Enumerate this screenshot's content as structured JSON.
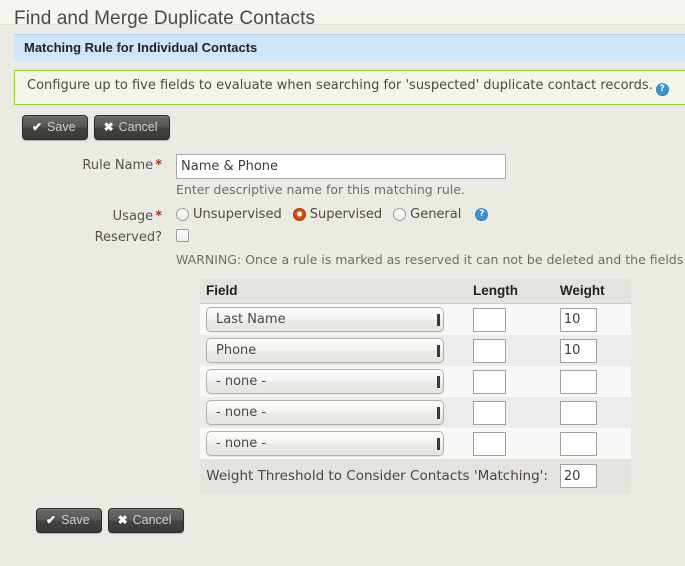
{
  "page": {
    "title": "Find and Merge Duplicate Contacts"
  },
  "section": {
    "header": "Matching Rule for Individual Contacts",
    "help_message": "Configure up to five fields to evaluate when searching for 'suspected' duplicate contact records.",
    "help_icon": "help-circle-icon"
  },
  "toolbar": {
    "save_label": "Save",
    "cancel_label": "Cancel",
    "save_glyph": "✔",
    "cancel_glyph": "✖"
  },
  "form": {
    "rule_name": {
      "label": "Rule Name",
      "required_marker": "*",
      "value": "Name & Phone",
      "placeholder": "",
      "hint": "Enter descriptive name for this matching rule."
    },
    "usage": {
      "label": "Usage",
      "required_marker": "*",
      "options": [
        {
          "label": "Unsupervised",
          "checked": false
        },
        {
          "label": "Supervised",
          "checked": true
        },
        {
          "label": "General",
          "checked": false
        }
      ],
      "help_icon": "help-circle-icon"
    },
    "reserved": {
      "label": "Reserved?",
      "checked": false,
      "warning": "WARNING: Once a rule is marked as reserved it can not be deleted and the fields ar"
    }
  },
  "rules_table": {
    "columns": {
      "field": "Field",
      "length": "Length",
      "weight": "Weight"
    },
    "rows": [
      {
        "field": "Last Name",
        "length": "",
        "weight": "10"
      },
      {
        "field": "Phone",
        "length": "",
        "weight": "10"
      },
      {
        "field": "- none -",
        "length": "",
        "weight": ""
      },
      {
        "field": "- none -",
        "length": "",
        "weight": ""
      },
      {
        "field": "- none -",
        "length": "",
        "weight": ""
      }
    ],
    "threshold": {
      "label": "Weight Threshold to Consider Contacts 'Matching':",
      "value": "20"
    }
  },
  "colors": {
    "section_header_bg": "#cfe5fa",
    "help_border": "#9ccb3b",
    "radio_selected": "#d9481f",
    "help_icon_bg": "#3b93d0",
    "required": "#a8301a",
    "page_bg": "#ecebe3"
  }
}
